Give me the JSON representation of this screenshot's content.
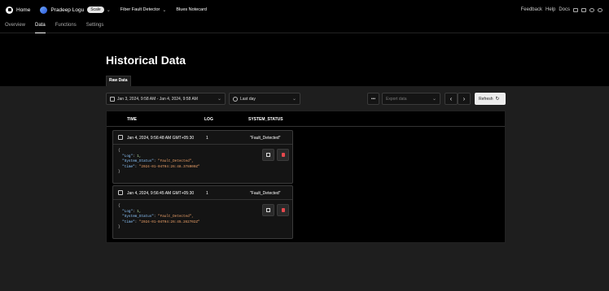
{
  "topbar": {
    "home": "Home",
    "user": "Pradeep Logu",
    "badge": "Scale",
    "project": "Fiber Fault Detector",
    "notecard": "Blues Notecard",
    "links": [
      "Feedback",
      "Help",
      "Docs"
    ]
  },
  "tabs": [
    "Overview",
    "Data",
    "Functions",
    "Settings"
  ],
  "active_tab": "Data",
  "page": {
    "title": "Historical Data",
    "subtab": "Raw Data"
  },
  "filters": {
    "date_range": "Jan 3, 2024, 9:58 AM - Jan 4, 2024, 9:58 AM",
    "time_window": "Last day",
    "more": "•••",
    "export_placeholder": "Export data",
    "prev": "‹",
    "next": "›",
    "refresh": "Refresh"
  },
  "table": {
    "columns": [
      "TIME",
      "LOG",
      "SYSTEM_STATUS"
    ],
    "rows": [
      {
        "time": "Jan 4, 2024, 9:56:48 AM GMT+05:30",
        "log": "1",
        "status": "\"Fault_Detected\"",
        "json": {
          "open": "{",
          "log_key": "\"Log\"",
          "log_val": "1,",
          "status_key": "\"System_Status\"",
          "status_val": "\"Fault_Detected\",",
          "time_key": "\"time\"",
          "time_val": "\"2024-01-04T04:26:48.378000Z\"",
          "close": "}"
        }
      },
      {
        "time": "Jan 4, 2024, 9:56:45 AM GMT+05:30",
        "log": "1",
        "status": "\"Fault_Detected\"",
        "json": {
          "open": "{",
          "log_key": "\"Log\"",
          "log_val": "1,",
          "status_key": "\"System_Status\"",
          "status_val": "\"Fault_Detected\",",
          "time_key": "\"time\"",
          "time_val": "\"2024-01-04T04:26:45.262702Z\"",
          "close": "}"
        }
      }
    ]
  }
}
